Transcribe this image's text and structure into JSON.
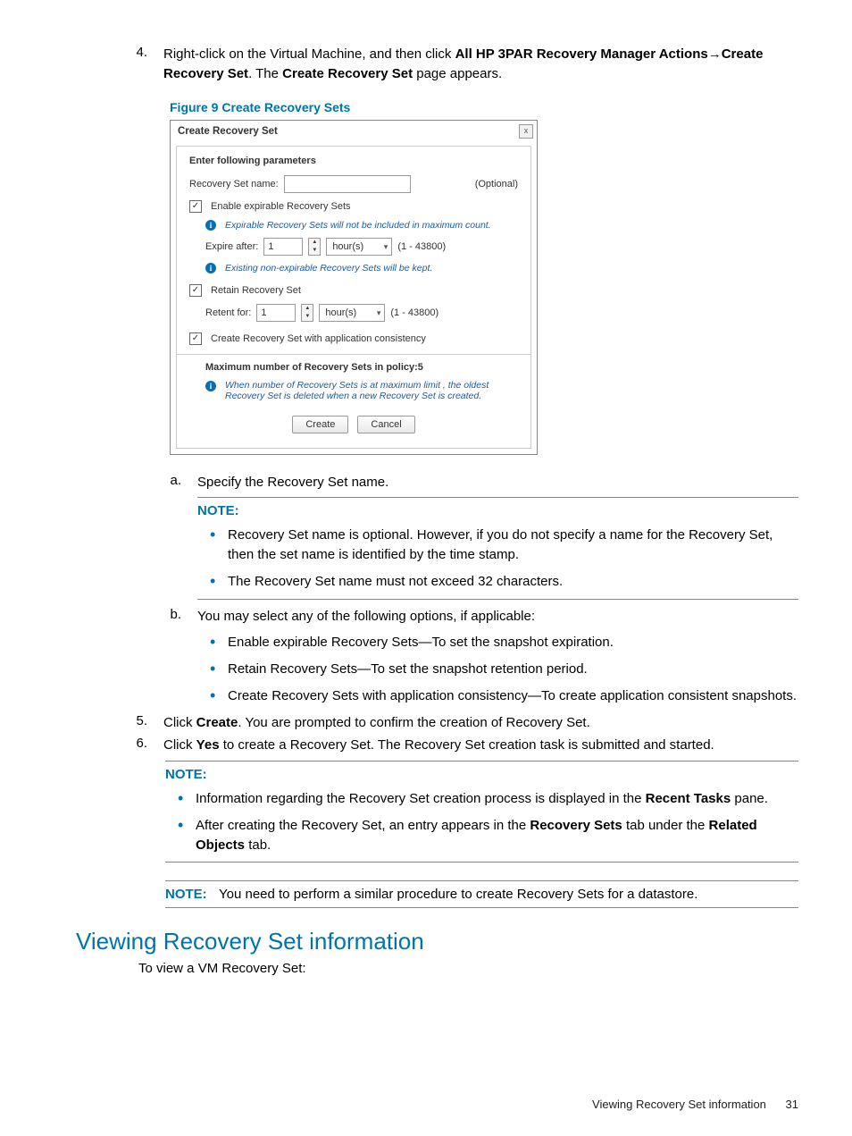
{
  "step4": {
    "num": "4.",
    "pre": "Right-click on the Virtual Machine, and then click ",
    "bold1": "All HP 3PAR Recovery Manager Actions",
    "arrow": "→",
    "bold2": "Create Recovery Set",
    "mid": ". The ",
    "bold3": "Create Recovery Set",
    "post": " page appears."
  },
  "figCaption": "Figure 9 Create Recovery Sets",
  "dialog": {
    "title": "Create Recovery Set",
    "close": "x",
    "heading": "Enter following parameters",
    "rsName": "Recovery Set name:",
    "optional": "(Optional)",
    "enableExp": "Enable expirable Recovery Sets",
    "expNote": "Expirable Recovery Sets will not be included in maximum count.",
    "expireAfter": "Expire after:",
    "numVal": "1",
    "unit": "hour(s)",
    "range": "(1 - 43800)",
    "nonExpNote": "Existing non-expirable Recovery Sets will be kept.",
    "retain": "Retain Recovery Set",
    "retentFor": "Retent for:",
    "appCons": "Create Recovery Set with application consistency",
    "maxLine": "Maximum number of Recovery Sets in policy:5",
    "maxNote": "When number of Recovery Sets is at maximum limit , the oldest Recovery Set is deleted when a new Recovery Set is created.",
    "create": "Create",
    "cancel": "Cancel"
  },
  "subA": {
    "l": "a.",
    "t": "Specify the Recovery Set name."
  },
  "noteLabel": "NOTE:",
  "noteA1": "Recovery Set name is optional. However, if you do not specify a name for the Recovery Set, then the set name is identified by the time stamp.",
  "noteA2": "The Recovery Set name must not exceed 32 characters.",
  "subB": {
    "l": "b.",
    "t": "You may select any of the following options, if applicable:"
  },
  "optB1": "Enable expirable Recovery Sets—To set the snapshot expiration.",
  "optB2": "Retain Recovery Sets—To set the snapshot retention period.",
  "optB3": "Create Recovery Sets with application consistency—To create application consistent snapshots.",
  "step5": {
    "num": "5.",
    "pre": "Click ",
    "b": "Create",
    "post": ". You are prompted to confirm the creation of Recovery Set."
  },
  "step6": {
    "num": "6.",
    "pre": "Click ",
    "b": "Yes",
    "post": " to create a Recovery Set. The Recovery Set creation task is submitted and started."
  },
  "note2a_pre": "Information regarding the Recovery Set creation process is displayed in the ",
  "note2a_b": "Recent Tasks",
  "note2a_post": " pane.",
  "note2b_pre": "After creating the Recovery Set, an entry appears in the ",
  "note2b_b1": "Recovery Sets",
  "note2b_mid": " tab under the ",
  "note2b_b2": "Related Objects",
  "note2b_post": " tab.",
  "finalNote": "You need to perform a similar procedure to create Recovery Sets for a datastore.",
  "sectionHeading": "Viewing Recovery Set information",
  "viewPara": "To view a VM Recovery Set:",
  "footerText": "Viewing Recovery Set information",
  "pageNum": "31"
}
